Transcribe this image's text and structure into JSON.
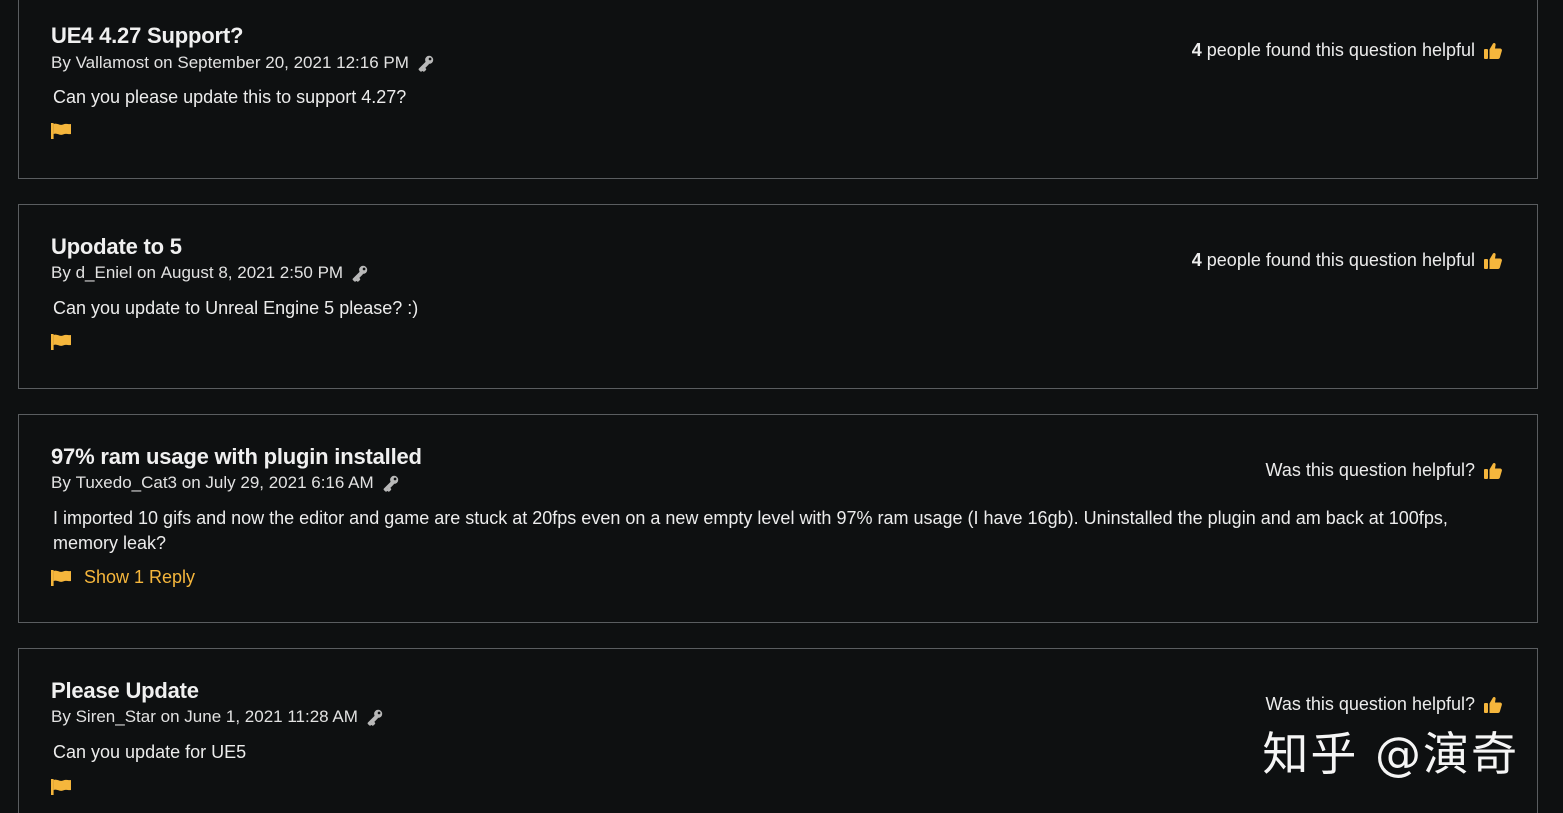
{
  "questions": [
    {
      "title": "UE4 4.27 Support?",
      "author_prefix": "By",
      "author": "Vallamost",
      "date_prefix": "on",
      "date": "September 20, 2021 12:16 PM",
      "body": "Can you please update this to support 4.27?",
      "helpful_count": "4",
      "helpful_text": "people found this question helpful",
      "reply_link": ""
    },
    {
      "title": "Upodate to 5",
      "author_prefix": "By",
      "author": "d_Eniel",
      "date_prefix": "on",
      "date": "August 8, 2021 2:50 PM",
      "body": "Can you update to Unreal Engine 5 please? :)",
      "helpful_count": "4",
      "helpful_text": "people found this question helpful",
      "reply_link": ""
    },
    {
      "title": "97% ram usage with plugin installed",
      "author_prefix": "By",
      "author": "Tuxedo_Cat3",
      "date_prefix": "on",
      "date": "July 29, 2021 6:16 AM",
      "body": "I imported 10 gifs and now the editor and game are stuck at 20fps even on a new empty level with 97% ram usage (I have 16gb). Uninstalled the plugin and am back at 100fps, memory leak?",
      "helpful_count": "",
      "helpful_text": "Was this question helpful?",
      "reply_link": "Show 1 Reply"
    },
    {
      "title": "Please Update",
      "author_prefix": "By",
      "author": "Siren_Star",
      "date_prefix": "on",
      "date": "June 1, 2021 11:28 AM",
      "body": "Can you update for UE5",
      "helpful_count": "",
      "helpful_text": "Was this question helpful?",
      "reply_link": ""
    }
  ],
  "watermark": "知乎 @演奇",
  "colors": {
    "background": "#0e1011",
    "border": "#5a5d60",
    "accent": "#f5b63c",
    "text": "#ececec",
    "key_icon": "#b8b8b8"
  },
  "icons": {
    "key": "key-icon",
    "flag": "flag-icon",
    "thumb": "thumbs-up-icon"
  }
}
